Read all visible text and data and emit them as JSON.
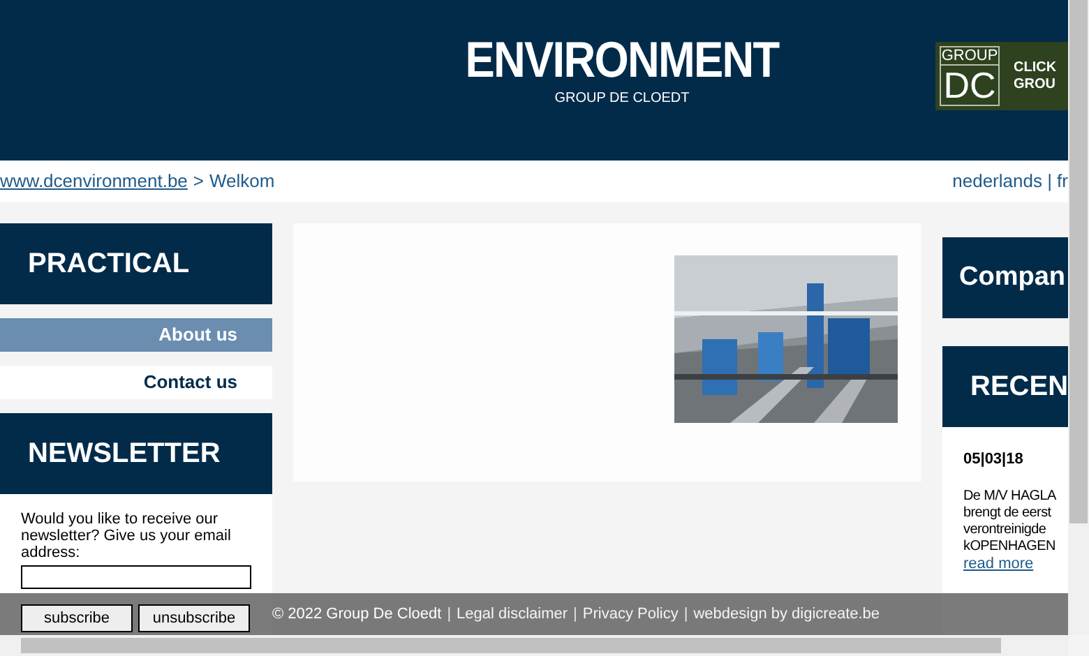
{
  "header": {
    "title": "ENVIRONMENT",
    "subtitle": "GROUP DE CLOEDT",
    "group_banner": {
      "logo_top": "GROUP",
      "logo_main": "DC",
      "line_1": "CLICK",
      "line_2": "GROU"
    }
  },
  "breadcrumb": {
    "link": "www.dcenvironment.be",
    "separator": ">",
    "current": "Welkom"
  },
  "languages": "nederlands | fr",
  "practical": {
    "title": "PRACTICAL",
    "items": [
      {
        "label": "About us",
        "selected": true
      },
      {
        "label": "Contact us",
        "selected": false
      }
    ]
  },
  "newsletter": {
    "title": "NEWSLETTER",
    "text": "Would you like to receive our newsletter? Give us your email address:",
    "buttons": [
      "subscribe",
      "unsubscribe"
    ]
  },
  "right": {
    "company_title": "Compan",
    "recent_title": "RECEN",
    "news": {
      "date": "05|03|18",
      "lines": [
        "De M/V HAGLA",
        "brengt de eerst",
        "verontreinigde",
        "kOPENHAGEN"
      ],
      "link": "read more"
    }
  },
  "footer": [
    {
      "kind": "text",
      "text": "© 2022 Group De Cloedt"
    },
    {
      "kind": "separator",
      "text": "|"
    },
    {
      "kind": "link",
      "text": "Legal disclaimer"
    },
    {
      "kind": "separator",
      "text": "|"
    },
    {
      "kind": "link",
      "text": "Privacy Policy"
    },
    {
      "kind": "separator",
      "text": "|"
    },
    {
      "kind": "link",
      "text": "webdesign by digicreate.be"
    }
  ]
}
